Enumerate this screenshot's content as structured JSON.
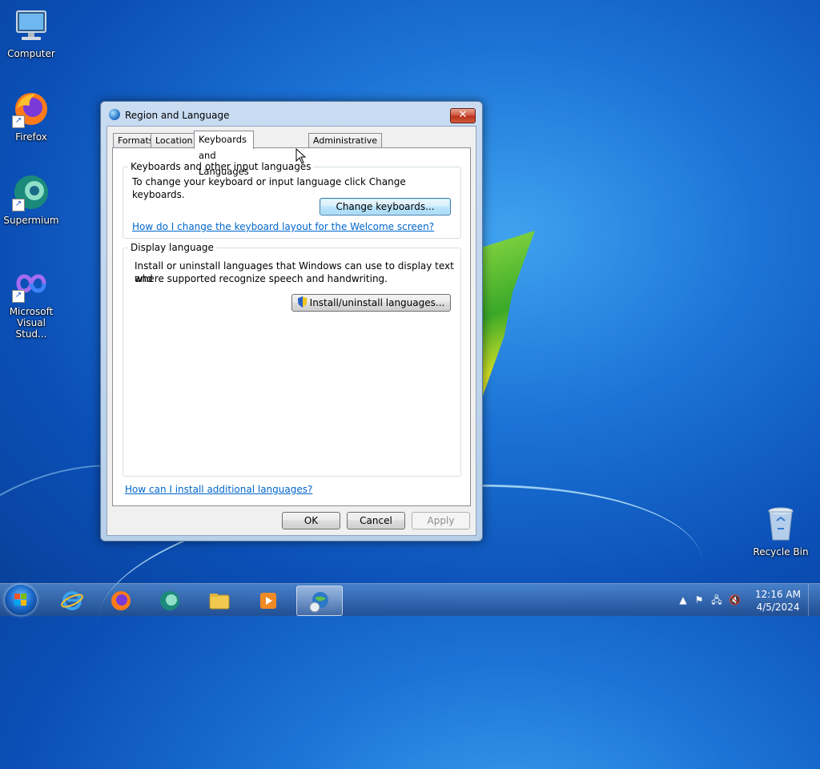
{
  "desktop": {
    "icons": [
      {
        "label": "Computer"
      },
      {
        "label": "Firefox"
      },
      {
        "label": "Supermium"
      },
      {
        "label": "Microsoft Visual Stud..."
      },
      {
        "label": "Recycle Bin"
      }
    ]
  },
  "dialog": {
    "title": "Region and Language",
    "close_label": "✕",
    "tabs": [
      {
        "label": "Formats"
      },
      {
        "label": "Location"
      },
      {
        "label": "Keyboards and Languages"
      },
      {
        "label": "Administrative"
      }
    ],
    "keyboards_group": {
      "label": "Keyboards and other input languages",
      "description": "To change your keyboard or input language click Change keyboards.",
      "button": "Change keyboards...",
      "link": "How do I change the keyboard layout for the Welcome screen?"
    },
    "display_group": {
      "label": "Display language",
      "description_line1": "Install or uninstall languages that Windows can use to display text and",
      "description_line2": "where supported recognize speech and handwriting.",
      "button": "Install/uninstall languages..."
    },
    "bottom_link": "How can I install additional languages?",
    "buttons": {
      "ok": "OK",
      "cancel": "Cancel",
      "apply": "Apply"
    }
  },
  "taskbar": {
    "clock_time": "12:16 AM",
    "clock_date": "4/5/2024"
  }
}
